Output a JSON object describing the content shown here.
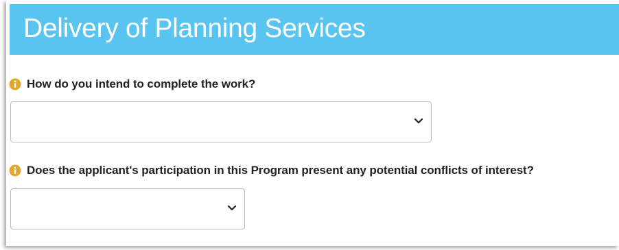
{
  "header": {
    "title": "Delivery of Planning Services",
    "background_color": "#5ac4f0"
  },
  "questions": [
    {
      "icon": "info-icon",
      "label": "How do you intend to complete the work?",
      "selected_value": ""
    },
    {
      "icon": "info-icon",
      "label": "Does the applicant's participation in this Program present any potential conflicts of interest?",
      "selected_value": ""
    }
  ],
  "colors": {
    "info_icon": "#e0a82e",
    "text": "#222222",
    "border": "#b9b9b9"
  }
}
